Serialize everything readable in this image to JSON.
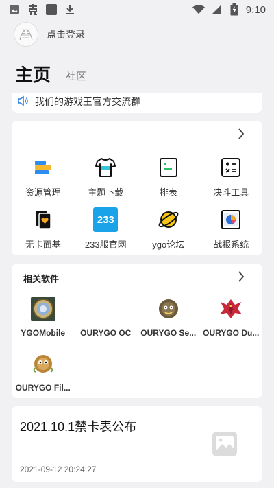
{
  "status_bar": {
    "time": "9:10",
    "icons": [
      "image-icon",
      "ghost-app-icon",
      "square-app-icon",
      "download-icon",
      "wifi-icon",
      "signal-icon",
      "battery-charging-icon"
    ]
  },
  "header": {
    "login_label": "点击登录",
    "tabs": [
      {
        "label": "主页",
        "active": true
      },
      {
        "label": "社区",
        "active": false
      }
    ]
  },
  "notice": {
    "text": "我们的游戏王官方交流群",
    "icon": "speaker-icon",
    "accent_color": "#2a7de1"
  },
  "tools": {
    "items": [
      {
        "label": "资源管理",
        "icon": "resource-stack-icon"
      },
      {
        "label": "主题下载",
        "icon": "tshirt-icon"
      },
      {
        "label": "排表",
        "icon": "deck-sheet-icon"
      },
      {
        "label": "决斗工具",
        "icon": "calculator-icon"
      },
      {
        "label": "无卡面基",
        "icon": "cards-heart-icon"
      },
      {
        "label": "233服官网",
        "icon": "site-233-icon",
        "badge": "233"
      },
      {
        "label": "ygo论坛",
        "icon": "planet-icon"
      },
      {
        "label": "战报系统",
        "icon": "report-chart-icon"
      }
    ]
  },
  "software": {
    "title": "相关软件",
    "items": [
      {
        "label": "YGOMobile",
        "icon": "ygomobile-icon"
      },
      {
        "label": "OURYGO OC",
        "icon": "blank-app-icon"
      },
      {
        "label": "OURYGO Se...",
        "icon": "furry-monster-icon"
      },
      {
        "label": "OURYGO Du...",
        "icon": "red-dragon-icon"
      },
      {
        "label": "OURYGO Fil...",
        "icon": "kuriboh-icon"
      }
    ]
  },
  "news": {
    "title": "2021.10.1禁卡表公布",
    "date": "2021-09-12 20:24:27",
    "thumb_icon": "image-placeholder-icon"
  }
}
